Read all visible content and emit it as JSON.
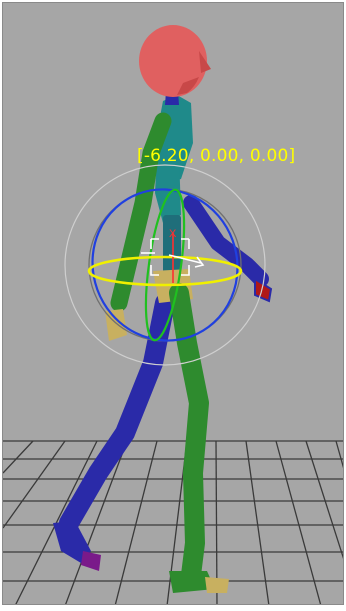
{
  "viewport": {
    "background": "#a6a6a6",
    "coordinate_readout": "[-6.20, 0.00, 0.00]",
    "readout_color": "#ffff00"
  },
  "gizmo": {
    "x_axis_label": "X"
  },
  "figure": {
    "head_color": "#e06060",
    "torso_color": "#1f8a8a",
    "left_limbs_color": "#2e8b2e",
    "right_limbs_color": "#2a2aa8",
    "pelvis_color": "#c8b060",
    "toe_color": "#7a1a8a"
  }
}
